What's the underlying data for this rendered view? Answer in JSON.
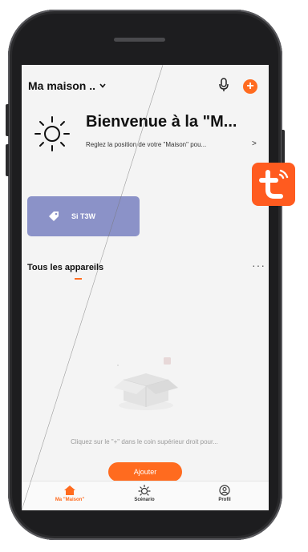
{
  "header": {
    "home_name": "Ma maison .."
  },
  "welcome": {
    "title": "Bienvenue à la \"M...",
    "subtitle": "Reglez la position de votre \"Maison\" pou...",
    "chevron": ">"
  },
  "scene_card": {
    "label": "Si T3W"
  },
  "devices": {
    "section_title": "Tous les appareils",
    "more": "···",
    "empty_text": "Cliquez sur le \"+\" dans le coin supérieur droit pour...",
    "add_button": "Ajouter"
  },
  "tabbar": {
    "tabs": [
      {
        "label": "Ma \"Maison\"",
        "icon": "home-icon",
        "active": true
      },
      {
        "label": "Scénario",
        "icon": "sun-icon",
        "active": false
      },
      {
        "label": "Profil",
        "icon": "profile-icon",
        "active": false
      }
    ]
  },
  "colors": {
    "accent": "#ff6b1f",
    "scene_card": "#8b92c8",
    "logo": "#ff5b1f"
  }
}
